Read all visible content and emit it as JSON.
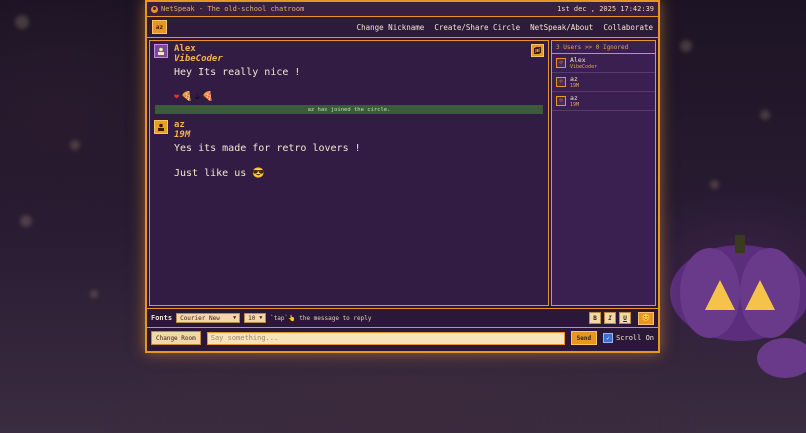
{
  "app": {
    "title": "NetSpeak - The old-school chatroom",
    "datetime": "1st dec , 2025 17:42:39",
    "user_badge": "az"
  },
  "menu": {
    "items": [
      "Change Nickname",
      "Create/Share Circle",
      "NetSpeak/About",
      "Collaborate"
    ]
  },
  "messages": [
    {
      "name": "Alex",
      "subtitle": "VibeCoder",
      "lines": [
        "Hey Its really nice !"
      ],
      "reactions": [
        "❤",
        "🍕",
        "☕",
        "🍕"
      ]
    },
    {
      "name": "az",
      "subtitle": "19M",
      "lines": [
        "Yes its made for retro lovers !",
        "Just like us 😎"
      ]
    }
  ],
  "system_messages": [
    "az has joined the circle."
  ],
  "users_panel": {
    "header": "3 Users >> 0 Ignored",
    "users": [
      {
        "name": "Alex",
        "sub": "VibeCoder"
      },
      {
        "name": "az",
        "sub": "19M"
      },
      {
        "name": "az",
        "sub": "19M"
      }
    ]
  },
  "toolbar": {
    "fonts_label": "Fonts",
    "font_value": "Courier New",
    "size_value": "10",
    "hint": "`tap`👆 the message to reply",
    "format_buttons": [
      "B",
      "I",
      "U"
    ],
    "emoji_icon": "😊"
  },
  "input": {
    "change_room": "Change Room",
    "placeholder": "Say something...",
    "send": "Send",
    "scroll_label": "Scroll On"
  },
  "colors": {
    "accent": "#e89524",
    "panel": "#321c44",
    "text": "#f3e6cf"
  }
}
